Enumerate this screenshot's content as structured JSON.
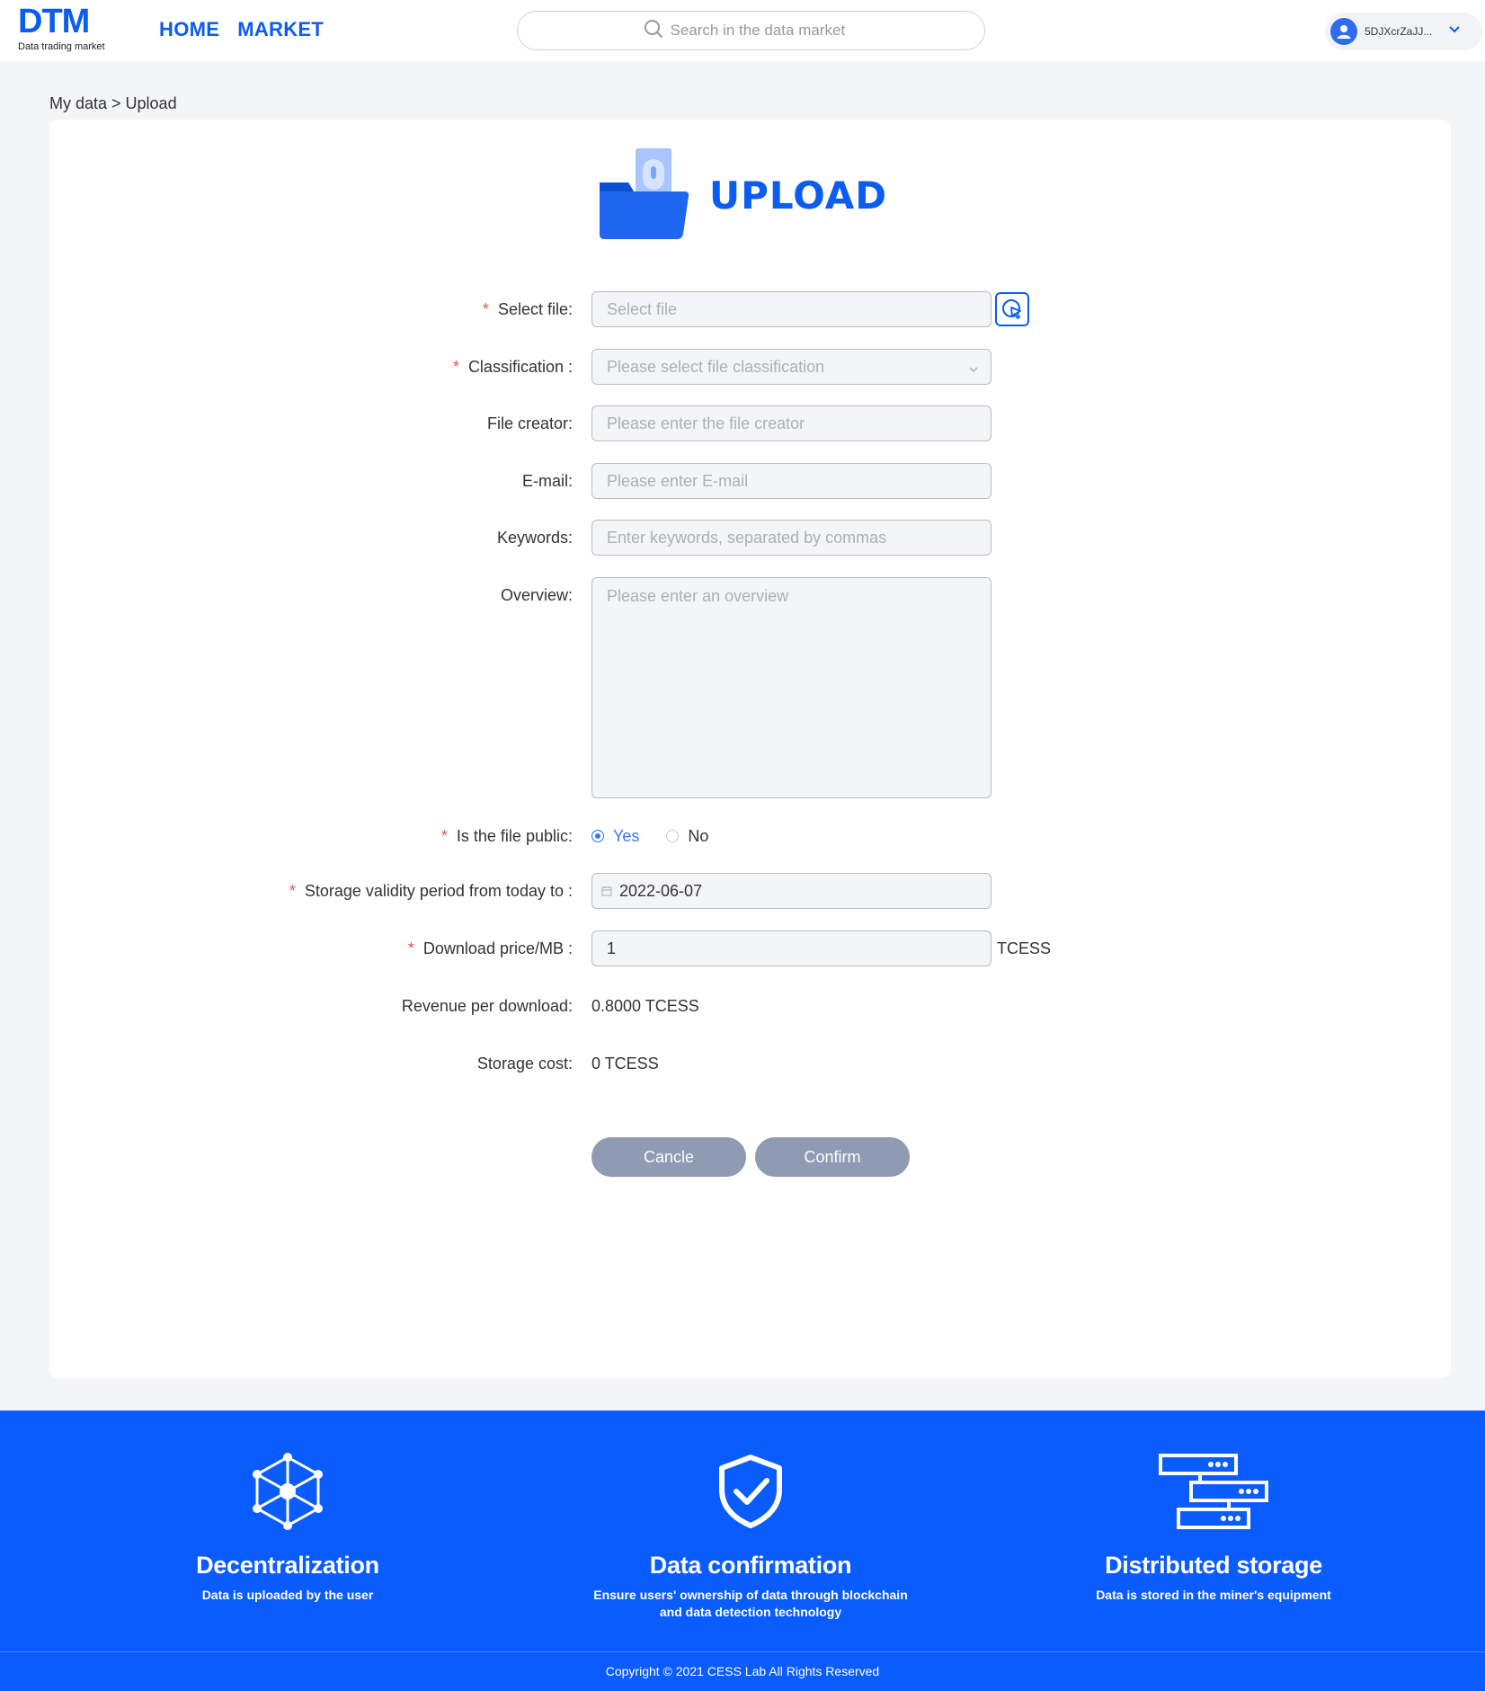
{
  "header": {
    "logo_text": "DTM",
    "logo_subtitle": "Data trading market",
    "nav": [
      {
        "label": "HOME"
      },
      {
        "label": "MARKET"
      }
    ],
    "search_placeholder": "Search in the data market",
    "user_name": "5DJXcrZaJJ..."
  },
  "breadcrumb": "My data > Upload",
  "upload_title": "UPLOAD",
  "form": {
    "select_file": {
      "label": "Select file",
      "placeholder": "Select file"
    },
    "classification": {
      "label": "Classification",
      "placeholder": "Please select file classification"
    },
    "file_creator": {
      "label": "File creator",
      "placeholder": "Please enter the file creator"
    },
    "email": {
      "label": "E-mail",
      "placeholder": "Please enter E-mail"
    },
    "keywords": {
      "label": "Keywords",
      "placeholder": "Enter keywords, separated by commas"
    },
    "overview": {
      "label": "Overview",
      "placeholder": "Please enter an overview"
    },
    "is_public": {
      "label": "Is the file public",
      "options": [
        "Yes",
        "No"
      ],
      "selected": "Yes"
    },
    "storage_period": {
      "label": "Storage validity period from today to",
      "value": "2022-06-07"
    },
    "download_price": {
      "label": "Download price/MB",
      "value": "1",
      "unit": "TCESS"
    },
    "revenue": {
      "label": "Revenue per download",
      "value": "0.8000 TCESS"
    },
    "storage_cost": {
      "label": "Storage cost",
      "value": "0 TCESS"
    }
  },
  "buttons": {
    "cancel": "Cancle",
    "confirm": "Confirm"
  },
  "footer": {
    "features": [
      {
        "title": "Decentralization",
        "text": "Data is uploaded by the user",
        "icon": "hexagon-network-icon"
      },
      {
        "title": "Data confirmation",
        "text": "Ensure users' ownership of data through blockchain and data detection technology",
        "icon": "shield-check-icon"
      },
      {
        "title": "Distributed storage",
        "text": "Data is stored in the miner's equipment",
        "icon": "server-stack-icon"
      }
    ],
    "copyright": "Copyright © 2021 CESS Lab All Rights Reserved"
  },
  "colors": {
    "brand": "#0b5cf0",
    "footer": "#0b5cff",
    "button": "#8f9ab3",
    "required": "#e5534b"
  }
}
